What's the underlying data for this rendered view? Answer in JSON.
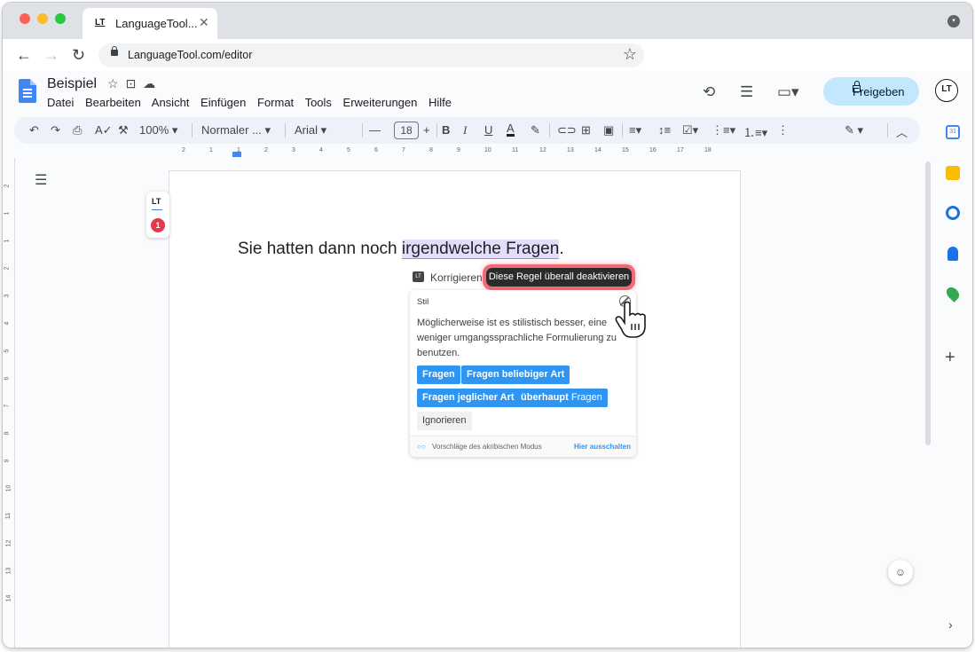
{
  "browser": {
    "tab_title": "LanguageTool...",
    "tab_close": "✕",
    "tab_favicon": "LT",
    "url": "LanguageTool.com/editor"
  },
  "docs": {
    "title": "Beispiel",
    "menus": [
      "Datei",
      "Bearbeiten",
      "Ansicht",
      "Einfügen",
      "Format",
      "Tools",
      "Erweiterungen",
      "Hilfe"
    ],
    "share_label": "Freigeben",
    "avatar": "LT"
  },
  "toolbar": {
    "zoom": "100%",
    "style": "Normaler ...",
    "font": "Arial",
    "font_size": "18"
  },
  "ruler": [
    "2",
    "1",
    "1",
    "2",
    "3",
    "4",
    "5",
    "6",
    "7",
    "8",
    "9",
    "10",
    "11",
    "12",
    "13",
    "14",
    "15",
    "16",
    "17",
    "18"
  ],
  "vruler": [
    "2",
    "1",
    "1",
    "2",
    "3",
    "4",
    "5",
    "6",
    "7",
    "8",
    "9",
    "10",
    "11",
    "12",
    "13",
    "14"
  ],
  "document": {
    "text_before": "Sie hatten dann noch ",
    "highlight": "irgendwelche Fragen",
    "text_after": "."
  },
  "languagetool": {
    "badge_logo": "LT",
    "error_count": "1",
    "korrigieren": "Korrigieren",
    "tooltip": "Diese Regel überall deaktivieren",
    "category": "Stil",
    "message": "Möglicherweise ist es stilistisch besser, eine weniger umgangssprachliche Formulierung zu benutzen.",
    "suggestions": [
      "Fragen",
      "Fragen beliebiger Art",
      "Fragen jeglicher Art"
    ],
    "suggestion_bold": "überhaupt",
    "suggestion_normal": "Fragen",
    "ignore": "Ignorieren",
    "footer_text": "Vorschläge des akribischen Modus",
    "footer_link": "Hier ausschalten"
  },
  "colors": {
    "suggestion_bg": "#2f95f0",
    "highlight_bg": "#e3ddfb",
    "tooltip_glow": "#f06a78",
    "share_bg": "#c2e7ff",
    "error_badge": "#e5364a"
  }
}
